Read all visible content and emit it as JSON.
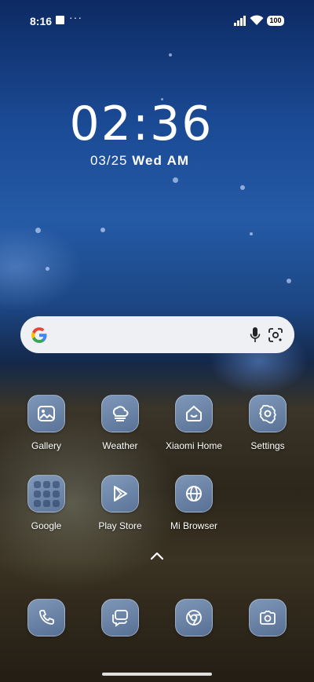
{
  "status_bar": {
    "time": "8:16",
    "dots": "···",
    "battery": "100"
  },
  "lock_clock": {
    "time": "02:36",
    "date": "03/25",
    "weekday": "Wed",
    "period": "AM"
  },
  "search": {
    "logo": "G"
  },
  "apps": [
    {
      "label": "Gallery",
      "icon": "gallery-icon"
    },
    {
      "label": "Weather",
      "icon": "weather-icon"
    },
    {
      "label": "Xiaomi Home",
      "icon": "home-icon"
    },
    {
      "label": "Settings",
      "icon": "gear-icon"
    },
    {
      "label": "Google",
      "icon": "folder-icon"
    },
    {
      "label": "Play Store",
      "icon": "play-store-icon"
    },
    {
      "label": "Mi Browser",
      "icon": "globe-icon"
    }
  ],
  "dock": [
    {
      "name": "phone",
      "icon": "phone-icon"
    },
    {
      "name": "messages",
      "icon": "message-icon"
    },
    {
      "name": "chrome",
      "icon": "chrome-icon"
    },
    {
      "name": "camera",
      "icon": "camera-icon"
    }
  ],
  "colors": {
    "icon_bg": "#7f9ec8",
    "search_bg": "#eef0f4",
    "google_blue": "#4285F4",
    "google_red": "#EA4335",
    "google_yellow": "#FBBC05",
    "google_green": "#34A853"
  }
}
